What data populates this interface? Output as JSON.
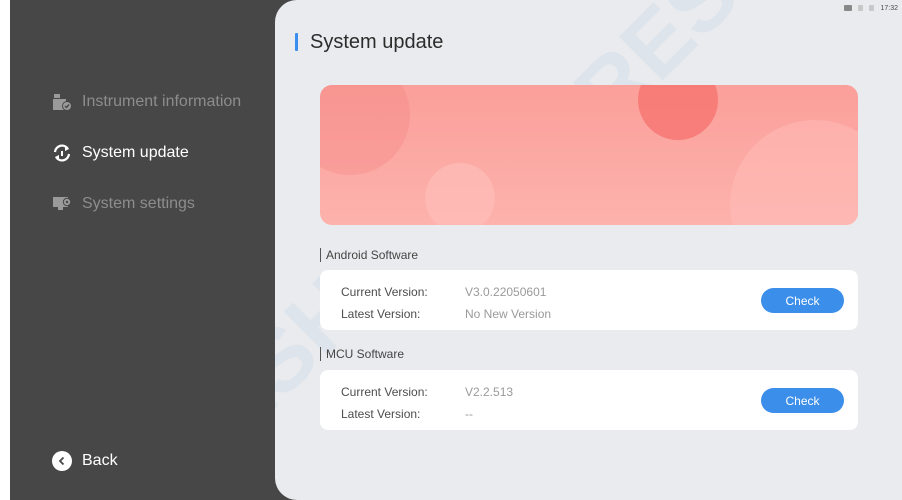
{
  "sidebar": {
    "items": [
      {
        "label": "Instrument information",
        "icon": "instrument-info-icon",
        "active": false
      },
      {
        "label": "System update",
        "icon": "refresh-icon",
        "active": true
      },
      {
        "label": "System settings",
        "icon": "settings-monitor-icon",
        "active": false
      }
    ],
    "back_label": "Back"
  },
  "status_bar": {
    "time": "17:32"
  },
  "watermark": "RESH",
  "main": {
    "title": "System update",
    "sections": [
      {
        "label": "Android Software",
        "current_label": "Current Version:",
        "current_value": "V3.0.22050601",
        "latest_label": "Latest Version:",
        "latest_value": "No New Version",
        "button_label": "Check"
      },
      {
        "label": "MCU Software",
        "current_label": "Current Version:",
        "current_value": "V2.2.513",
        "latest_label": "Latest Version:",
        "latest_value": "--",
        "button_label": "Check"
      }
    ]
  },
  "colors": {
    "accent": "#3b8eea",
    "sidebar_bg": "#474747",
    "content_bg": "#eaebee",
    "banner": "#fba5a0"
  }
}
